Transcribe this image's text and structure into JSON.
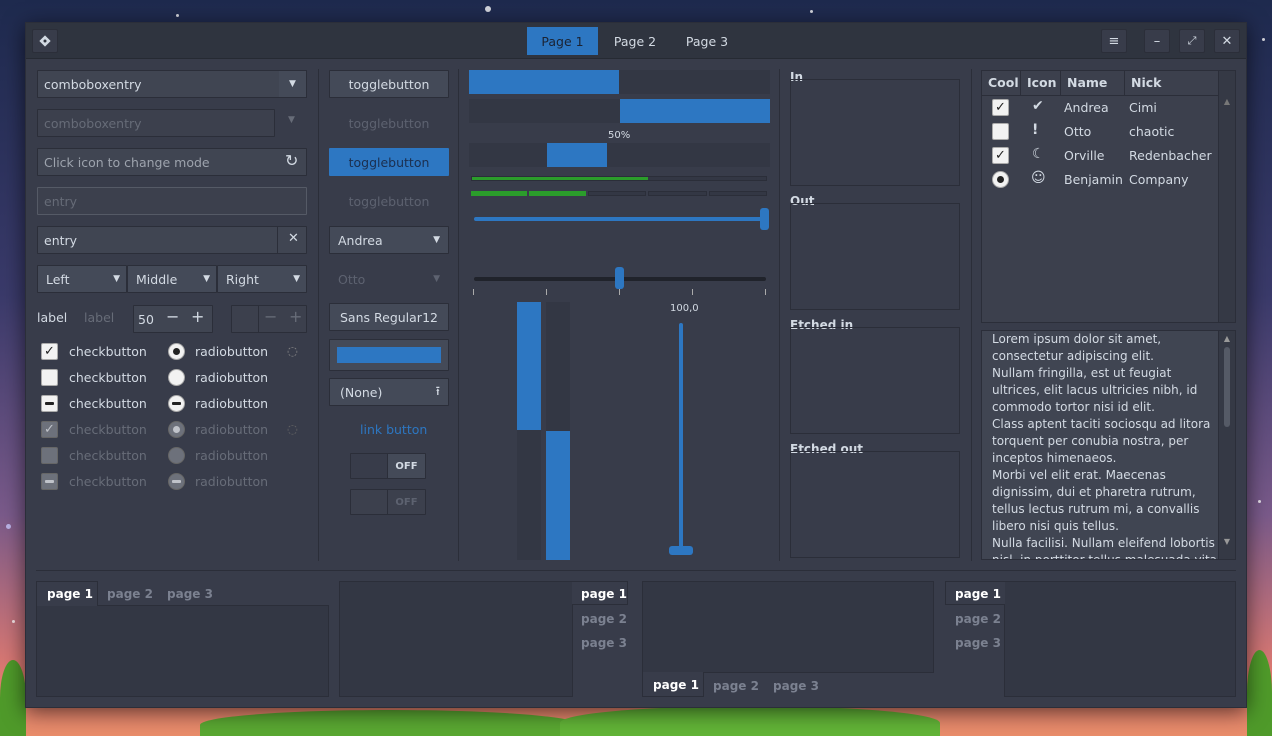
{
  "header": {
    "tabs": [
      "Page 1",
      "Page 2",
      "Page 3"
    ],
    "menu_icon": "hamburger-icon",
    "min_icon": "minimize-icon",
    "max_icon": "maximize-icon",
    "close_icon": "close-icon"
  },
  "col1": {
    "combo1": "comboboxentry",
    "combo2": "comboboxentry",
    "entry_icon": "Click icon to change mode",
    "entry_dis": "entry",
    "entry_clear": "entry",
    "seg_left": "Left",
    "seg_middle": "Middle",
    "seg_right": "Right",
    "label1": "label",
    "label2": "label",
    "spin_value": "50",
    "checks": [
      "checkbutton",
      "checkbutton",
      "checkbutton",
      "checkbutton",
      "checkbutton",
      "checkbutton"
    ],
    "radios": [
      "radiobutton",
      "radiobutton",
      "radiobutton",
      "radiobutton",
      "radiobutton",
      "radiobutton"
    ]
  },
  "col2": {
    "toggle": [
      "togglebutton",
      "togglebutton",
      "togglebutton",
      "togglebutton"
    ],
    "combo_andrea": "Andrea",
    "combo_otto": "Otto",
    "font_name": "Sans Regular",
    "font_size": "12",
    "file_none": "(None)",
    "link": "link button",
    "switch_off": "OFF"
  },
  "col3": {
    "progress_text": "50%",
    "scale_value": "100,0",
    "levels": {
      "green1": 0.59,
      "green2": 0.39
    },
    "progress_fraction": 0.5
  },
  "frames": [
    "In",
    "Out",
    "Etched in",
    "Etched out"
  ],
  "tree": {
    "headers": [
      "Cool",
      "Icon",
      "Name",
      "Nick"
    ],
    "rows": [
      {
        "name": "Andrea",
        "nick": "Cimi",
        "icon": "check-circle-icon"
      },
      {
        "name": "Otto",
        "nick": "chaotic",
        "icon": "exclamation-icon"
      },
      {
        "name": "Orville",
        "nick": "Redenbacher",
        "icon": "moon-icon"
      },
      {
        "name": "Benjamin",
        "nick": "Company",
        "icon": "face-icon"
      }
    ]
  },
  "textview": [
    "Lorem ipsum dolor sit amet,",
    "consectetur adipiscing elit.",
    "Nullam fringilla, est ut feugiat",
    "ultrices, elit lacus ultricies nibh, id",
    "commodo tortor nisi id elit.",
    "Class aptent taciti sociosqu ad litora",
    "torquent per conubia nostra, per",
    "inceptos himenaeos.",
    "Morbi vel elit erat. Maecenas",
    "dignissim, dui et pharetra rutrum,",
    "tellus lectus rutrum mi, a convallis",
    "libero nisi quis tellus.",
    "Nulla facilisi. Nullam eleifend lobortis",
    "nisl, in porttitor tellus malesuada vitae."
  ],
  "notebooks": [
    "page 1",
    "page 2",
    "page 3"
  ]
}
